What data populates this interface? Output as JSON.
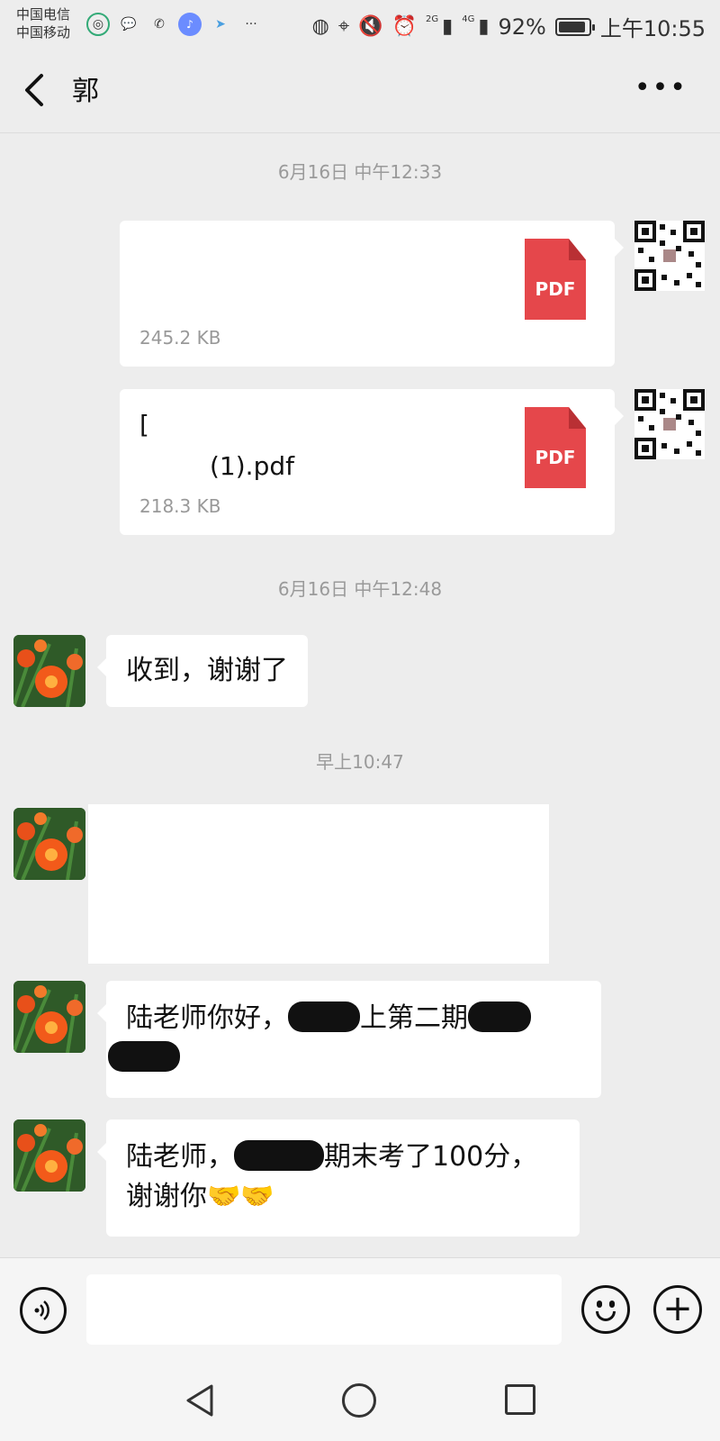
{
  "status_bar": {
    "carrier_1": "中国电信",
    "carrier_2": "中国移动",
    "signal_1": "2G",
    "signal_2": "4G",
    "battery": "92%",
    "battery_level": 0.92,
    "time": "上午10:55"
  },
  "header": {
    "back_icon": "chevron-left-icon",
    "title": "郭",
    "more_label": "•••"
  },
  "messages": [
    {
      "type": "timestamp",
      "text": "6月16日 中午12:33"
    },
    {
      "type": "file",
      "sender": "me",
      "name": "",
      "size": "245.2 KB",
      "file_type": "PDF"
    },
    {
      "type": "file",
      "sender": "me",
      "name_line1": "[",
      "name_line2": "(1).pdf",
      "size": "218.3 KB",
      "file_type": "PDF"
    },
    {
      "type": "timestamp",
      "text": "6月16日 中午12:48"
    },
    {
      "type": "text",
      "sender": "other",
      "text": "收到，谢谢了"
    },
    {
      "type": "timestamp",
      "text": "早上10:47"
    },
    {
      "type": "image",
      "sender": "other"
    },
    {
      "type": "text",
      "sender": "other",
      "text_visible_1": "陆老师你好，",
      "text_visible_2": "上第二期",
      "note": ""
    },
    {
      "type": "text",
      "sender": "other",
      "text_visible_1": "陆老师，",
      "text_visible_2": "期末考了100分，",
      "text_line2": "谢谢你",
      "emoji": "🤝🤝"
    }
  ],
  "input_bar": {
    "voice_icon": "voice-icon",
    "input_value": "",
    "emoji_icon": "emoji-icon",
    "plus_icon": "plus-icon"
  },
  "colors": {
    "background": "#ededed",
    "bubble": "#ffffff",
    "pdf": "#e5474b",
    "timestamp": "#9a9a9a"
  }
}
